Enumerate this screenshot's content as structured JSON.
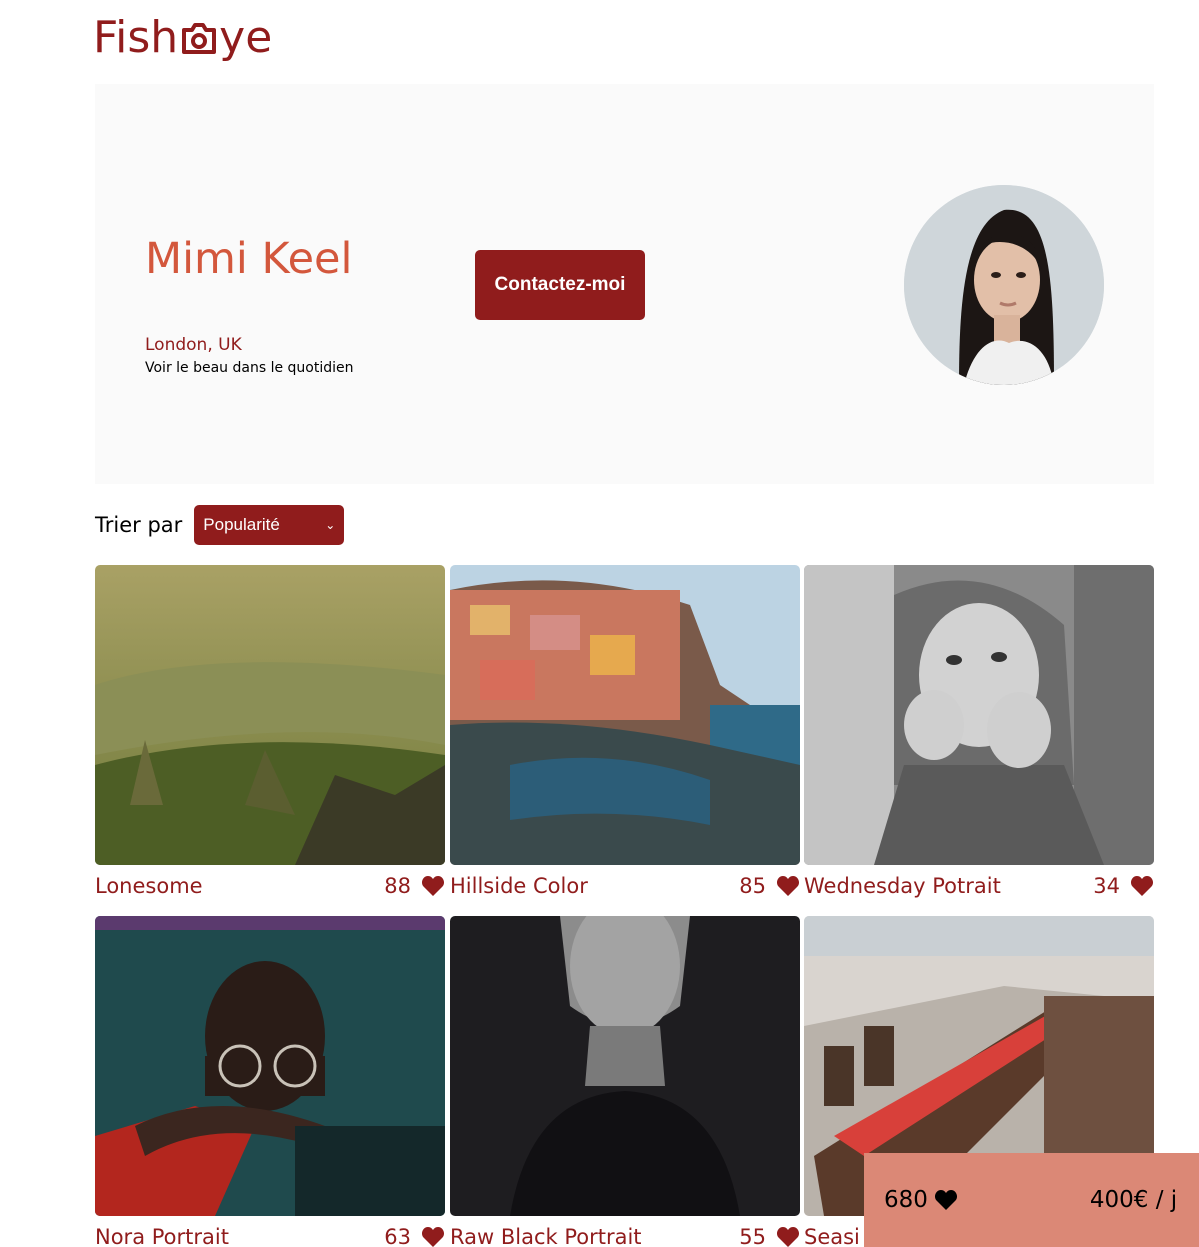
{
  "brand": {
    "logo_text": "FishEye",
    "prefix": "Fish",
    "suffix": "ye",
    "color": "#901c1c"
  },
  "photographer": {
    "name": "Mimi Keel",
    "location": "London, UK",
    "tagline": "Voir le beau dans le quotidien",
    "contact_label": "Contactez-moi"
  },
  "sort": {
    "label": "Trier par",
    "selected": "Popularité"
  },
  "media": [
    {
      "title": "Lonesome",
      "likes": "88"
    },
    {
      "title": "Hillside Color",
      "likes": "85"
    },
    {
      "title": "Wednesday Potrait",
      "likes": "34"
    },
    {
      "title": "Nora Portrait",
      "likes": "63"
    },
    {
      "title": "Raw Black Portrait",
      "likes": "55"
    },
    {
      "title": "Seasi",
      "likes": ""
    }
  ],
  "footer": {
    "total_likes": "680",
    "price": "400€ / j"
  },
  "colors": {
    "primary": "#901c1c",
    "accent_name": "#d3573c",
    "footer_bg": "#db8876",
    "header_bg": "#fafafa"
  }
}
